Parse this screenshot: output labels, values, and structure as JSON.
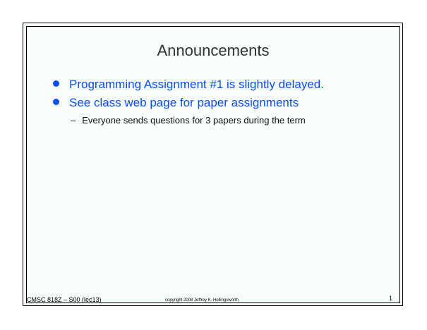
{
  "title": "Announcements",
  "bullets": [
    "Programming Assignment #1 is slightly delayed.",
    "See class web page for paper assignments"
  ],
  "sub_bullets": [
    "Everyone sends questions for 3 papers during the term"
  ],
  "sub_dash": "–",
  "footer": {
    "course": "CMSC 818Z – S00  (lec13)",
    "copyright": "copyright  2008 Jeffrey K. Hollingsworth",
    "page": "1"
  }
}
